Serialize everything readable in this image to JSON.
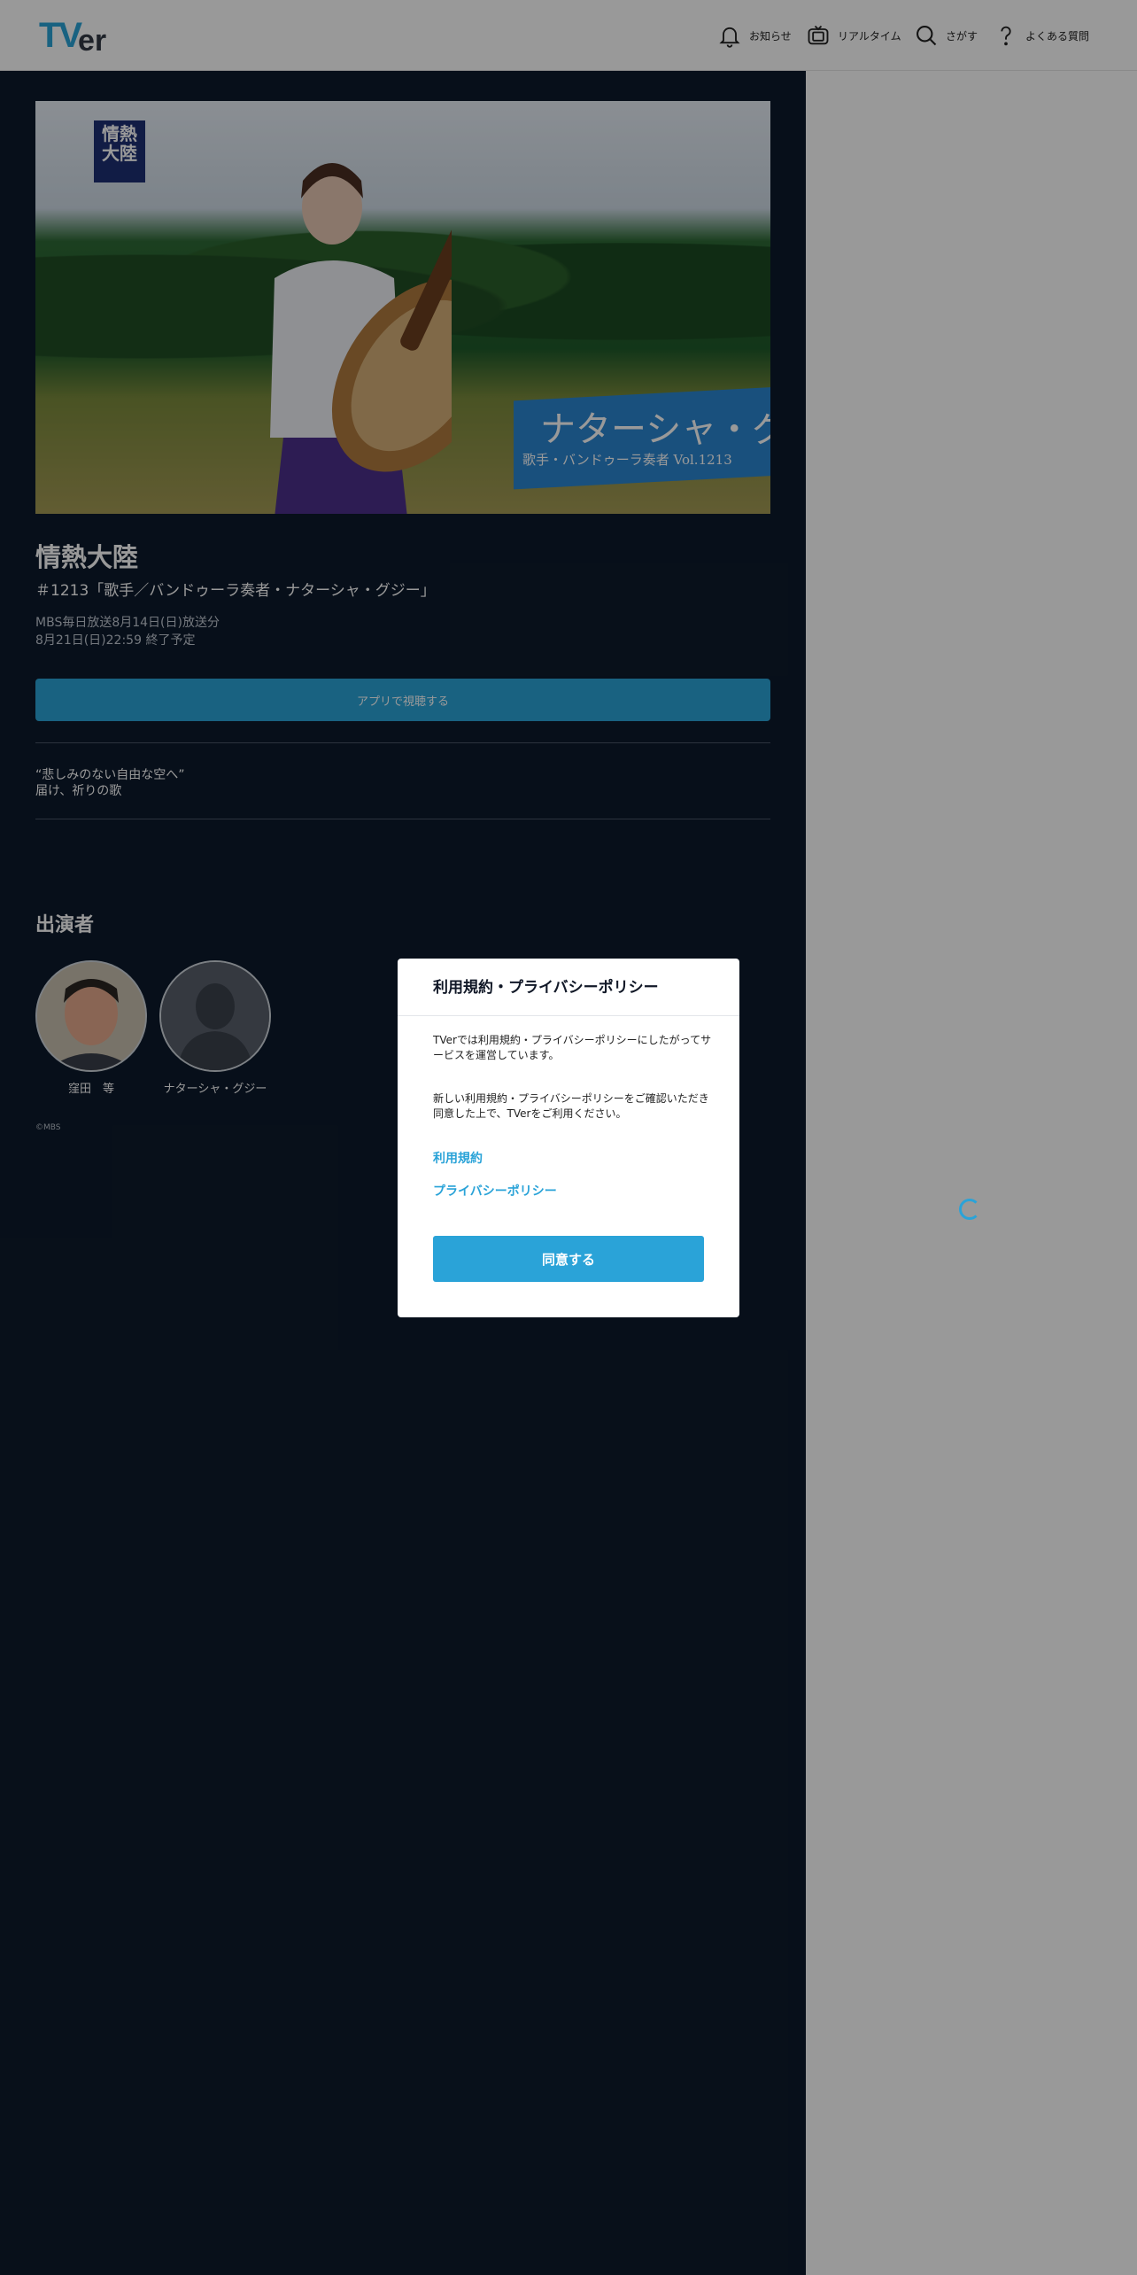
{
  "header": {
    "logo": "TVer",
    "nav": [
      {
        "label": "お知らせ",
        "icon": "bell-icon"
      },
      {
        "label": "リアルタイム",
        "icon": "tv-icon"
      },
      {
        "label": "さがす",
        "icon": "search-icon"
      },
      {
        "label": "よくある質問",
        "icon": "question-icon"
      }
    ]
  },
  "episode": {
    "thumbnail": {
      "badge": "情熱大陸",
      "banner_title": "ナターシャ・グジー",
      "banner_subtitle": "歌手・バンドゥーラ奏者 Vol.1213"
    },
    "title": "情熱大陸",
    "subtitle": "＃1213「歌手／バンドゥーラ奏者・ナターシャ・グジー」",
    "broadcast": "MBS毎日放送8月14日(日)放送分",
    "expires": "8月21日(日)22:59 終了予定",
    "app_button": "アプリで視聴する",
    "description": [
      "“悲しみのない自由な空へ”",
      "届け、祈りの歌"
    ],
    "cast_heading": "出演者",
    "cast": [
      {
        "name": "窪田　等"
      },
      {
        "name": "ナターシャ・グジー"
      }
    ],
    "copyright": "©MBS"
  },
  "modal": {
    "title": "利用規約・プライバシーポリシー",
    "text1": "TVerでは利用規約・プライバシーポリシーにしたがってサービスを運営しています。",
    "text2": "新しい利用規約・プライバシーポリシーをご確認いただき同意した上で、TVerをご利用ください。",
    "link_terms": "利用規約",
    "link_privacy": "プライバシーポリシー",
    "agree_button": "同意する"
  },
  "colors": {
    "accent": "#2aa3d8",
    "panel": "#0d1a2c",
    "overlay": "rgba(0,0,0,0.40)"
  }
}
